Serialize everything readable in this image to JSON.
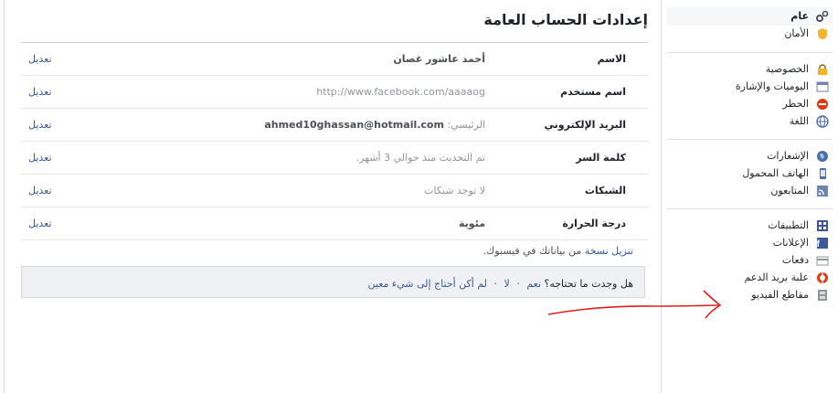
{
  "page_title": "إعدادات الحساب العامة",
  "rows": [
    {
      "label": "الاسم",
      "value_prefix": "",
      "value": "أحمد عاشور غصان",
      "edit": "تعديل"
    },
    {
      "label": "اسم مستخدم",
      "value_prefix": "",
      "value": "http://www.facebook.com/aaaaog",
      "edit": "تعديل"
    },
    {
      "label": "البريد الإلكتروني",
      "value_prefix": "الرئيسي:",
      "value": "ahmed10ghassan@hotmail.com",
      "edit": "تعديل"
    },
    {
      "label": "كلمة السر",
      "value_prefix": "",
      "value": "تم التحديث منذ حوالي 3 أشهر.",
      "edit": "تعديل"
    },
    {
      "label": "الشبكات",
      "value_prefix": "",
      "value": "لا توجد شبكات",
      "edit": "تعديل"
    },
    {
      "label": "درجة الحرارة",
      "value_prefix": "",
      "value": "مئوية",
      "edit": "تعديل"
    }
  ],
  "download": {
    "link": "تنزيل نسخة",
    "rest": "من بياناتك في فيسبوك."
  },
  "help": {
    "question": "هل وجدت ما تحتاجه؟",
    "yes": "نعم",
    "separator": "·",
    "no": "لا",
    "no_extra": "لم أكن أحتاج إلى شيء معين"
  },
  "sidebar": {
    "items": [
      {
        "label": "عام",
        "icon": "gear-icon",
        "color": "#4b4f56"
      },
      {
        "label": "الأمان",
        "icon": "badge-icon",
        "color": "#f5b22a"
      },
      {
        "label": "الخصوصية",
        "icon": "lock-icon",
        "color": "#f5b22a"
      },
      {
        "label": "اليوميات والإشارة",
        "icon": "timeline-icon",
        "color": "#6d84b4"
      },
      {
        "label": "الحظر",
        "icon": "block-icon",
        "color": "#dd3c10"
      },
      {
        "label": "اللغة",
        "icon": "globe-icon",
        "color": "#4a6ea9"
      },
      {
        "label": "الإشعارات",
        "icon": "globe-notifications-icon",
        "color": "#4a6ea9"
      },
      {
        "label": "الهاتف المحمول",
        "icon": "mobile-icon",
        "color": "#4a6ea9"
      },
      {
        "label": "المتابعون",
        "icon": "rss-icon",
        "color": "#6d84b4"
      },
      {
        "label": "التطبيقات",
        "icon": "apps-icon",
        "color": "#3b5998"
      },
      {
        "label": "الإعلانات",
        "icon": "ads-icon",
        "color": "#3b5998"
      },
      {
        "label": "دفعات",
        "icon": "card-icon",
        "color": "#90949c"
      },
      {
        "label": "علبة بريد الدعم",
        "icon": "lifebuoy-icon",
        "color": "#dd3c10"
      },
      {
        "label": "مقاطع الفيديو",
        "icon": "film-icon",
        "color": "#90949c"
      }
    ]
  }
}
